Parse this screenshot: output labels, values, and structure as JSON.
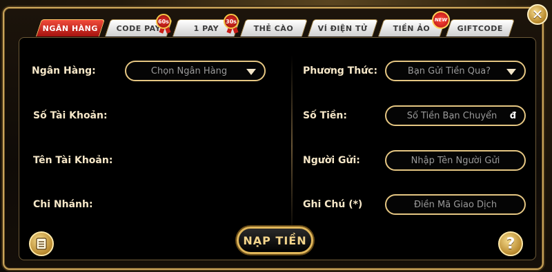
{
  "tabs": [
    {
      "label": "NGÂN HÀNG",
      "active": true
    },
    {
      "label": "CODE PAY",
      "badge": "60s"
    },
    {
      "label": "1 PAY",
      "badge": "30s"
    },
    {
      "label": "THẺ CÀO"
    },
    {
      "label": "VÍ ĐIỆN TỬ"
    },
    {
      "label": "TIỀN ẢO",
      "badge": "NEW"
    },
    {
      "label": "GIFTCODE"
    }
  ],
  "left": {
    "bank_label": "Ngân Hàng:",
    "bank_select": "Chọn Ngân Hàng",
    "account_number_label": "Số Tài Khoản:",
    "account_name_label": "Tên Tài Khoản:",
    "branch_label": "Chi Nhánh:"
  },
  "right": {
    "method_label": "Phương Thức:",
    "method_select": "Bạn Gửi Tiền Qua?",
    "amount_label": "Số Tiền:",
    "amount_placeholder": "Số Tiền Bạn Chuyển",
    "currency_symbol": "đ",
    "sender_label": "Người Gửi:",
    "sender_placeholder": "Nhập Tên Người Gửi",
    "note_label": "Ghi Chú (*)",
    "note_placeholder": "Điền Mã Giao Dịch"
  },
  "submit_label": "NẠP TIỀN",
  "close_glyph": "✕",
  "help_glyph": "?",
  "icons": {
    "close": "close-icon",
    "history": "notepad-icon",
    "help": "question-icon"
  },
  "colors": {
    "gold": "#e6c783",
    "active_tab": "#c81e18",
    "label": "#f6e7c8"
  }
}
